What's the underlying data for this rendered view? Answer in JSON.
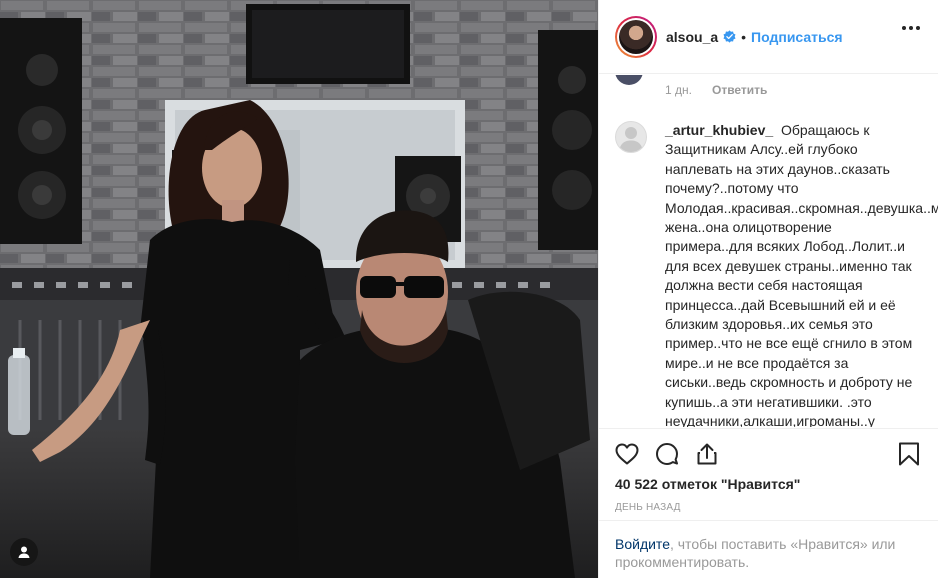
{
  "post": {
    "username": "alsou_a",
    "separator": "•",
    "follow_label": "Подписаться"
  },
  "previous_comment": {
    "time": "1 дн.",
    "reply_label": "Ответить"
  },
  "comment": {
    "username": "_artur_khubiev_",
    "text": "Обращаюсь к Защитникам Алсу..ей глубоко наплевать на этих даунов..сказать почему?..потому что Молодая..красивая..скромная..девушка..мама..и жена..она олицотворение примера..для всяких Лобод..Лолит..и для всех девушек страны..именно так должна вести себя настоящая принцесса..дай Всевышний ей и её близким здоровья..их семья это пример..что не все ещё сгнило в этом мире..и не все продаётся за сиськи..ведь скромность и доброту не купишь..а эти негатившики. .это неудачники,алкаши,игроманы..у"
  },
  "stats": {
    "likes": "40 522 отметок \"Нравится\"",
    "date": "день назад"
  },
  "login_prompt": {
    "link": "Войдите",
    "rest": ", чтобы поставить «Нравится» или прокомментировать."
  },
  "icons": [
    "verified-badge-icon",
    "more-options-icon",
    "heart-icon",
    "comment-icon",
    "share-icon",
    "bookmark-icon",
    "user-tag-icon"
  ],
  "colors": {
    "accent": "#3897f0",
    "text": "#262626",
    "muted": "#999999",
    "link_dark": "#003569"
  }
}
